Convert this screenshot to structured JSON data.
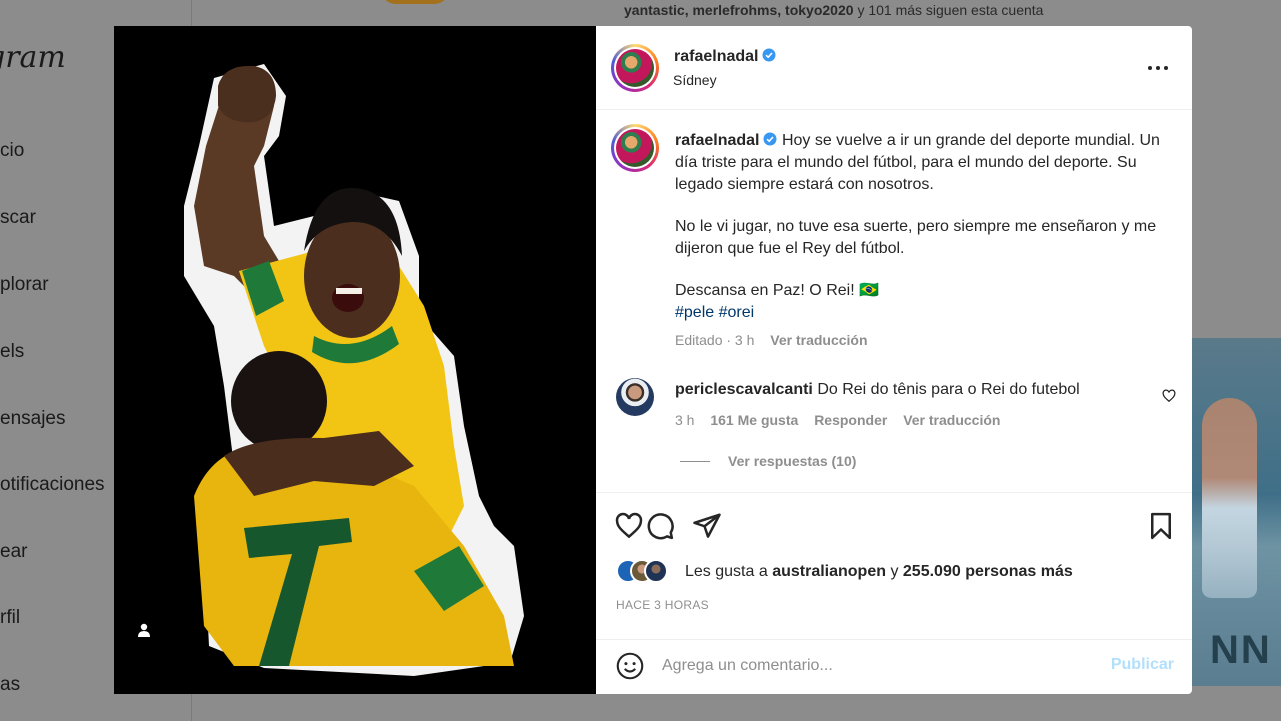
{
  "background": {
    "logo": "gram",
    "nav": [
      "cio",
      "scar",
      "plorar",
      "els",
      "ensajes",
      "otificaciones",
      "ear",
      "rfil",
      "as"
    ],
    "suggestion": {
      "names": "yantastic, merlefrohms, tokyo2020",
      "rest": "y 101 más siguen esta cuenta"
    }
  },
  "post": {
    "author": "rafaelnadal",
    "location": "Sídney",
    "caption": {
      "username": "rafaelnadal",
      "para1": "Hoy se vuelve a ir un grande del deporte mundial. Un día triste para el mundo del fútbol, para el mundo del deporte. Su legado siempre estará con nosotros.",
      "para2": "No le vi jugar, no tuve esa suerte, pero siempre me enseñaron y me dijeron que fue el Rey del fútbol.",
      "para3": "Descansa en Paz! O Rei! 🇧🇷",
      "hashtags": "#pele #orei",
      "edited": "Editado · 3 h",
      "translate": "Ver traducción"
    },
    "comment": {
      "username": "periclescavalcanti",
      "text": "Do Rei do tênis para o Rei do futebol",
      "time": "3 h",
      "likes": "161 Me gusta",
      "reply": "Responder",
      "translate": "Ver traducción",
      "view_replies": "Ver respuestas (10)"
    },
    "likes": {
      "prefix": "Les gusta a",
      "user": "australianopen",
      "mid": "y",
      "count": "255.090 personas más"
    },
    "time_ago": "HACE 3 HORAS",
    "add_comment": {
      "placeholder": "Agrega un comentario...",
      "post_label": "Publicar"
    }
  },
  "colors": {
    "verified": "#3897f0",
    "link": "#00376b",
    "muted": "#8e8e8e",
    "publish_disabled": "#b2dffc"
  }
}
